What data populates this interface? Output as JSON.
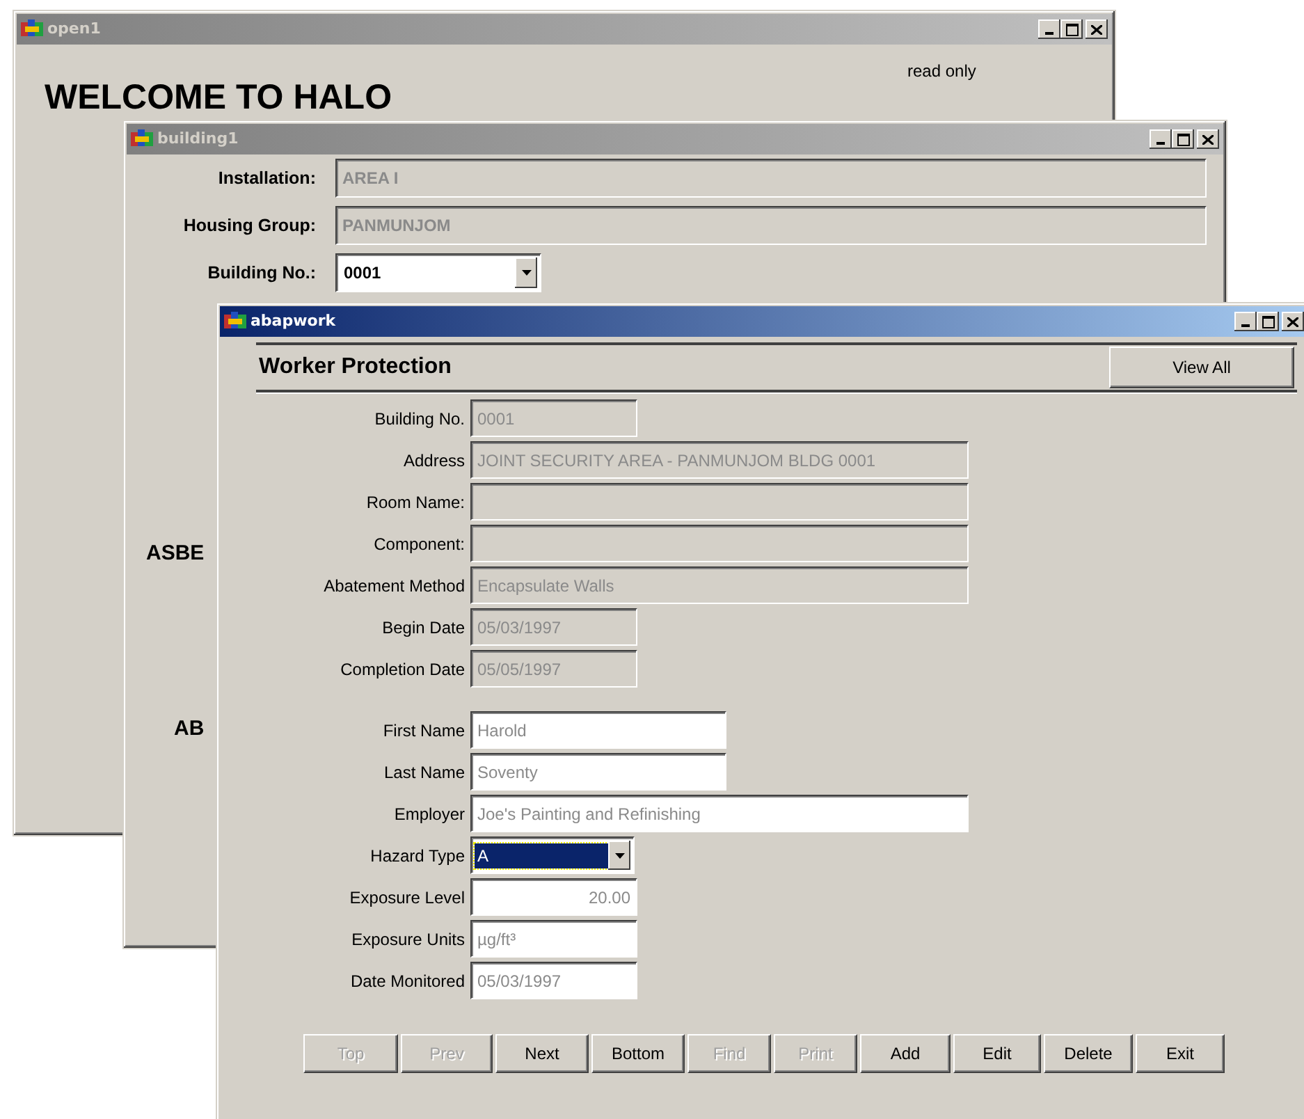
{
  "windows": [
    {
      "kind": "welcome",
      "title": "open1",
      "active": false,
      "heading": "WELCOME TO HALO",
      "note": "read only"
    },
    {
      "kind": "building",
      "title": "building1",
      "active": false,
      "fields": [
        {
          "label": "Installation:",
          "value": "AREA I",
          "kind": "readonly"
        },
        {
          "label": "Housing Group:",
          "value": "PANMUNJOM",
          "kind": "readonly"
        },
        {
          "label": "Building No.:",
          "value": "0001",
          "kind": "dropdown",
          "focused": false
        }
      ],
      "partial_labels": [
        "ASBE",
        "AB"
      ]
    },
    {
      "kind": "form",
      "title": "abapwork",
      "active": true,
      "header": "Worker Protection",
      "view_all": "View All",
      "record_fields": [
        {
          "label": "Building No.",
          "value": "0001",
          "kind": "readonly"
        },
        {
          "label": "Address",
          "value": "JOINT SECURITY AREA - PANMUNJOM BLDG 0001",
          "kind": "readonly"
        },
        {
          "label": "Room Name:",
          "kind": "readonly"
        },
        {
          "label": "Component:",
          "kind": "readonly"
        },
        {
          "label": "Abatement Method",
          "value": "Encapsulate Walls",
          "kind": "readonly"
        },
        {
          "label": "Begin Date",
          "value": "05/03/1997",
          "kind": "readonly"
        },
        {
          "label": "Completion Date",
          "value": "05/05/1997",
          "kind": "readonly"
        }
      ],
      "worker_fields": [
        {
          "label": "First Name",
          "value": "Harold",
          "kind": "editable"
        },
        {
          "label": "Last Name",
          "value": "Soventy",
          "kind": "editable"
        },
        {
          "label": "Employer",
          "value": "Joe's Painting and Refinishing",
          "kind": "editable"
        },
        {
          "label": "Hazard Type",
          "value": "A",
          "kind": "dropdown",
          "focused": true
        },
        {
          "label": "Exposure Level",
          "value": "20.00",
          "kind": "number"
        },
        {
          "label": "Exposure Units",
          "value": "µg/ft³",
          "kind": "editable"
        },
        {
          "label": "Date Monitored",
          "value": "05/03/1997",
          "kind": "editable"
        }
      ],
      "buttons": [
        {
          "label": "Top",
          "disabled": true
        },
        {
          "label": "Prev",
          "disabled": true
        },
        {
          "label": "Next",
          "disabled": false
        },
        {
          "label": "Bottom",
          "disabled": false
        },
        {
          "label": "Find",
          "disabled": true
        },
        {
          "label": "Print",
          "disabled": true
        },
        {
          "label": "Add",
          "disabled": false
        },
        {
          "label": "Edit",
          "disabled": false
        },
        {
          "label": "Delete",
          "disabled": false
        },
        {
          "label": "Exit",
          "disabled": false
        }
      ]
    }
  ]
}
